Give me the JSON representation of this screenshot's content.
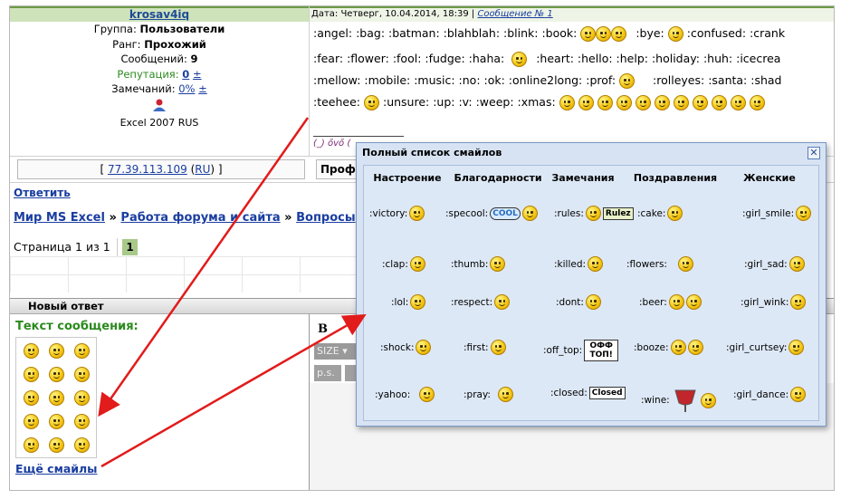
{
  "profile": {
    "username": "krosav4iq",
    "group_label": "Группа:",
    "group": "Пользователи",
    "rank_label": "Ранг:",
    "rank": "Прохожий",
    "posts_label": "Сообщений:",
    "posts": "9",
    "reputation_label": "Репутация:",
    "reputation": "0",
    "reputation_pm": "±",
    "warnings_label": "Замечаний:",
    "warnings": "0%",
    "warnings_pm": "±",
    "software": "Excel 2007 RUS"
  },
  "message": {
    "date_label": "Дата: Четверг, 10.04.2014, 18:39 |",
    "msg_label": "Сообщение №",
    "msg_number": "1",
    "rows": [
      ":angel: :bag: :batman: :blahblah: :blink: :book:",
      ":bye:",
      ":confused: :crank",
      ":fear: :flower: :fool: :fudge: :haha:",
      ":heart: :hello: :help: :holiday: :huh: :icecrea",
      ":mellow: :mobile: :music: :no: :ok: :online2long: :prof:",
      ":rolleyes: :santa: :shad",
      ":teehee:",
      ":unsure: :up: :v: :weep: :xmas:"
    ],
    "signature": "(_) ővő ("
  },
  "ip": {
    "open": "[",
    "address": "77.39.113.109",
    "country": "RU",
    "close": "]"
  },
  "profile_button": "Профи",
  "reply_link": "Ответить",
  "breadcrumbs": [
    "Мир MS Excel",
    "»",
    "Работа форума и сайта",
    "»",
    "Вопросы"
  ],
  "pagination": {
    "text": "Страница 1 из 1",
    "current": "1"
  },
  "new_reply": {
    "title": "Новый ответ",
    "message_label": "Текст сообщения:",
    "more_smiles": "Ещё смайлы"
  },
  "editor": {
    "bold": "B",
    "size": "SIZE",
    "ps": "p.s."
  },
  "popup": {
    "title": "Полный список смайлов",
    "close": "✕",
    "columns": [
      "Настроение",
      "Благодарности",
      "Замечания",
      "Поздравления",
      "Женские"
    ],
    "rows": [
      [
        ":victory:",
        ":specool:",
        ":rules:",
        ":cake:",
        ":girl_smile:"
      ],
      [
        ":clap:",
        ":thumb:",
        ":killed:",
        ":flowers:",
        ":girl_sad:"
      ],
      [
        ":lol:",
        ":respect:",
        ":dont:",
        ":beer:",
        ":girl_wink:"
      ],
      [
        ":shock:",
        ":first:",
        ":off_top:",
        ":booze:",
        ":girl_curtsey:"
      ],
      [
        ":yahoo:",
        ":pray:",
        ":closed:",
        ":wine:",
        ":girl_dance:"
      ]
    ],
    "badges": {
      "specool": "COOL",
      "rules": "Rulez",
      "offtop": "ОФФ ТОП!",
      "closed": "Closed"
    }
  },
  "colors": {
    "header_green": "#cfe3bb",
    "link_blue": "#1a3ea0",
    "label_green": "#2b8a1e",
    "popup_bg": "#d7e3f3",
    "arrow_red": "#e21b1b"
  }
}
